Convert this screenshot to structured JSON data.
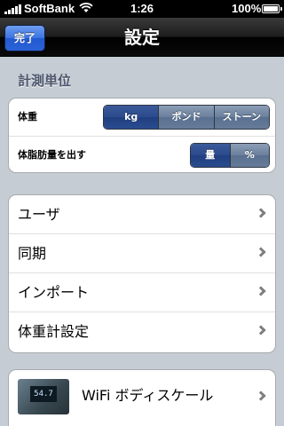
{
  "status_bar": {
    "carrier": "SoftBank",
    "time": "1:26",
    "battery": "100%"
  },
  "nav": {
    "title": "設定",
    "done_label": "完了"
  },
  "measurement": {
    "header": "計測単位",
    "weight": {
      "label": "体重",
      "options": [
        "kg",
        "ポンド",
        "ストーン"
      ],
      "selected": "kg"
    },
    "body_fat": {
      "label": "体脂肪量を出す",
      "options": [
        "量",
        "%"
      ],
      "selected": "量"
    }
  },
  "menu": {
    "items": [
      {
        "label": "ユーザ"
      },
      {
        "label": "同期"
      },
      {
        "label": "インポート"
      },
      {
        "label": "体重計設定"
      }
    ]
  },
  "device": {
    "label": "WiFi ボディスケール",
    "display_value": "54.7"
  },
  "colors": {
    "background": "#c5ccd4",
    "selected_segment": "#2a4a8c",
    "done_button": "#3a72e0"
  }
}
